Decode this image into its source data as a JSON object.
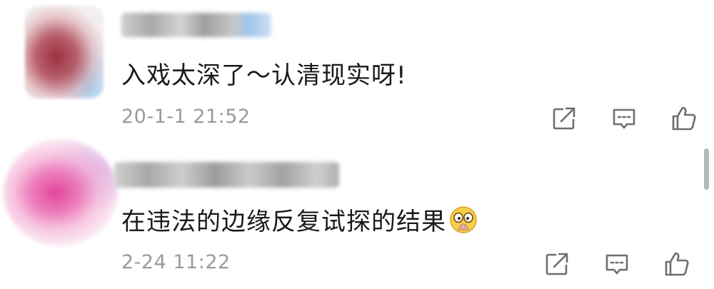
{
  "comments": [
    {
      "username": "",
      "text": "入戏太深了～认清现实呀!",
      "time": "20-1-1 21:52",
      "emoji": null,
      "actions": {
        "share_icon": "share-icon",
        "reply_icon": "comment-icon",
        "like_icon": "thumbs-up-icon"
      }
    },
    {
      "username": "",
      "text": "在违法的边缘反复试探的结果",
      "time": "2-24 11:22",
      "emoji": "facepalm-emoji",
      "actions": {
        "share_icon": "share-icon",
        "reply_icon": "comment-icon",
        "like_icon": "thumbs-up-icon"
      }
    }
  ],
  "colors": {
    "text": "#1a1a1a",
    "meta": "#9a9a9a",
    "icon": "#6e6e6e"
  }
}
